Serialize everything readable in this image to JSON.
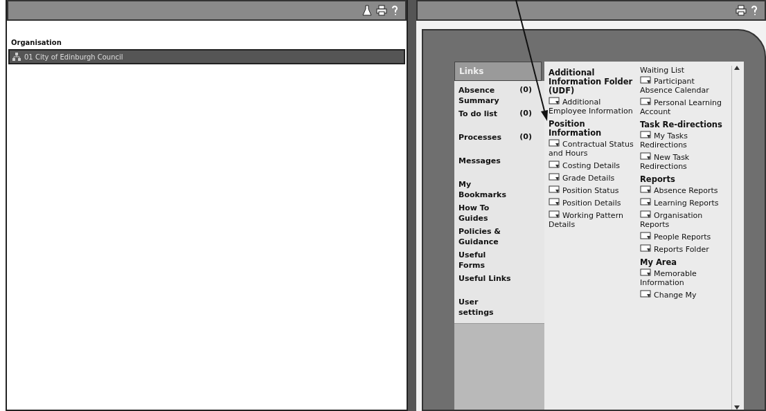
{
  "left_panel": {
    "heading": "Organisation",
    "rows": [
      {
        "text": "01 City of Edinburgh Council",
        "selected": true
      }
    ]
  },
  "right_panel": {
    "tab": "Links",
    "links": [
      {
        "label": "Absence Summary",
        "count": "(0)"
      },
      {
        "label": "To do list",
        "count": "(0)"
      },
      {
        "label": "Processes",
        "count": "(0)"
      },
      {
        "label": "Messages"
      },
      {
        "label": "My Bookmarks"
      },
      {
        "label": "How To Guides"
      },
      {
        "label": "Policies & Guidance"
      },
      {
        "label": "Useful Forms"
      },
      {
        "label": "Useful Links"
      },
      {
        "label": "User settings"
      }
    ],
    "columns": [
      {
        "entries": [
          {
            "kind": "heading",
            "text": "Additional Information Folder (UDF)"
          },
          {
            "kind": "link",
            "text": "Additional Employee Information"
          },
          {
            "kind": "heading",
            "text": "Position Information"
          },
          {
            "kind": "link",
            "text": "Contractual Status and Hours"
          },
          {
            "kind": "link",
            "text": "Costing Details"
          },
          {
            "kind": "link",
            "text": "Grade Details"
          },
          {
            "kind": "link",
            "text": "Position Status"
          },
          {
            "kind": "link",
            "text": "Position Details"
          },
          {
            "kind": "link",
            "text": "Working Pattern Details"
          }
        ]
      },
      {
        "entries": [
          {
            "kind": "text",
            "text": "Waiting List"
          },
          {
            "kind": "link",
            "text": "Participant Absence Calendar"
          },
          {
            "kind": "link",
            "text": "Personal Learning Account"
          },
          {
            "kind": "heading",
            "text": "Task Re-directions"
          },
          {
            "kind": "link",
            "text": "My Tasks Redirections"
          },
          {
            "kind": "link",
            "text": "New Task Redirections"
          },
          {
            "kind": "heading",
            "text": "Reports"
          },
          {
            "kind": "link",
            "text": "Absence Reports"
          },
          {
            "kind": "link",
            "text": "Learning Reports"
          },
          {
            "kind": "link",
            "text": "Organisation Reports"
          },
          {
            "kind": "link",
            "text": "People Reports"
          },
          {
            "kind": "link",
            "text": "Reports Folder"
          },
          {
            "kind": "heading",
            "text": "My Area"
          },
          {
            "kind": "link",
            "text": "Memorable Information"
          },
          {
            "kind": "link",
            "text": "Change My"
          }
        ]
      }
    ]
  }
}
